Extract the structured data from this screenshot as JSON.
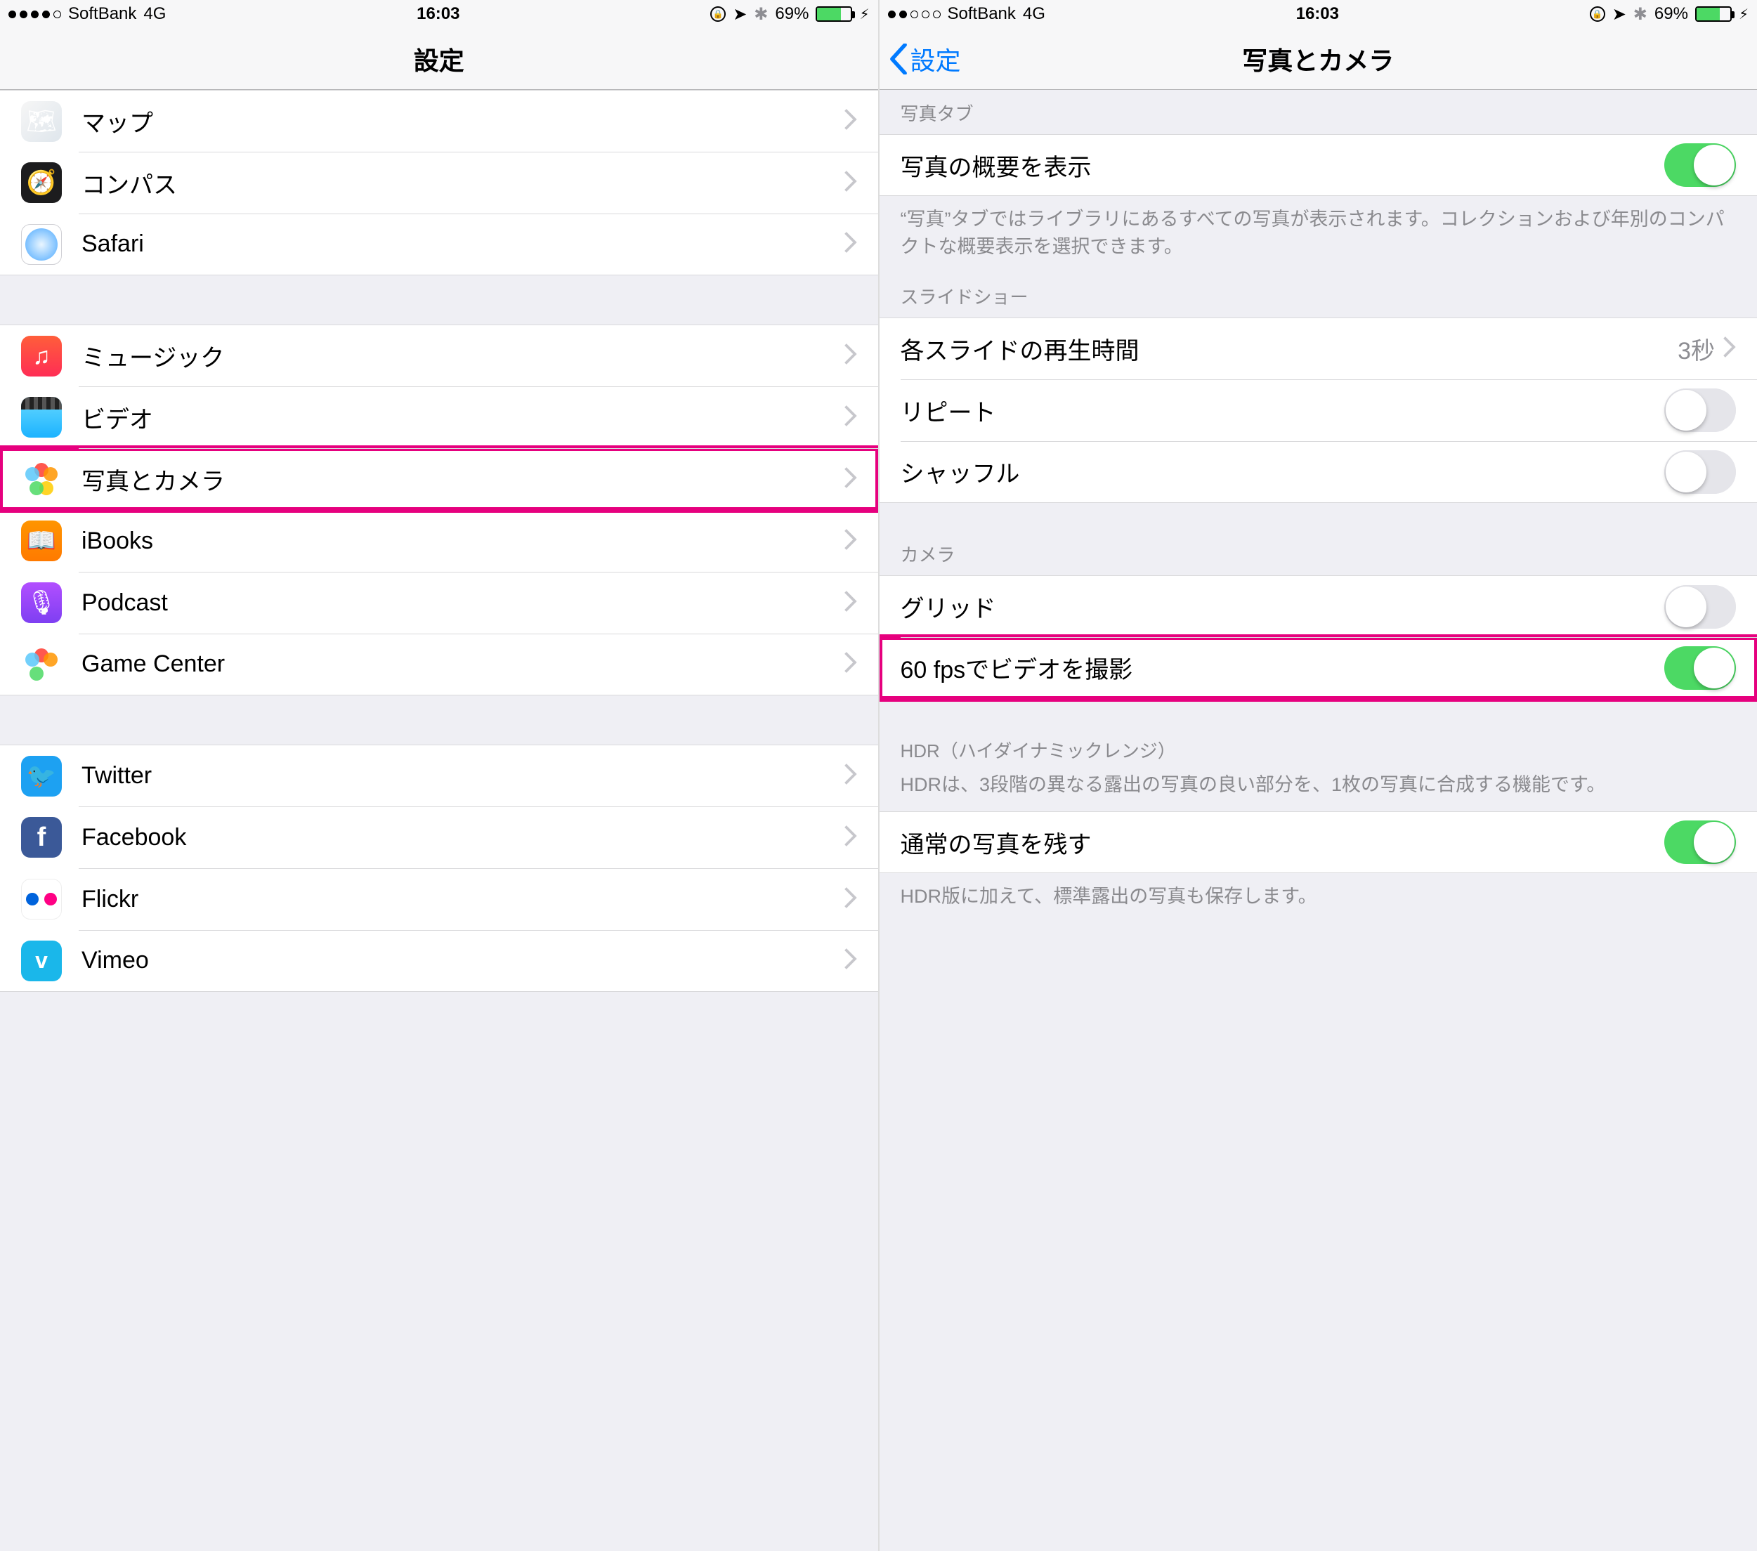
{
  "status": {
    "carrier": "SoftBank",
    "network": "4G",
    "time": "16:03",
    "battery_pct": "69%",
    "signal_left_full": 4,
    "signal_right_full": 2
  },
  "left": {
    "title": "設定",
    "groups": [
      {
        "items": [
          {
            "key": "maps",
            "label": "マップ",
            "icon": "maps-icon"
          },
          {
            "key": "compass",
            "label": "コンパス",
            "icon": "compass-icon"
          },
          {
            "key": "safari",
            "label": "Safari",
            "icon": "safari-icon"
          }
        ]
      },
      {
        "items": [
          {
            "key": "music",
            "label": "ミュージック",
            "icon": "music-icon"
          },
          {
            "key": "video",
            "label": "ビデオ",
            "icon": "video-icon"
          },
          {
            "key": "photos",
            "label": "写真とカメラ",
            "icon": "photos-icon",
            "highlight": true
          },
          {
            "key": "ibooks",
            "label": "iBooks",
            "icon": "ibooks-icon"
          },
          {
            "key": "podcast",
            "label": "Podcast",
            "icon": "podcast-icon"
          },
          {
            "key": "gamecenter",
            "label": "Game Center",
            "icon": "gamecenter-icon"
          }
        ]
      },
      {
        "items": [
          {
            "key": "twitter",
            "label": "Twitter",
            "icon": "twitter-icon"
          },
          {
            "key": "facebook",
            "label": "Facebook",
            "icon": "facebook-icon"
          },
          {
            "key": "flickr",
            "label": "Flickr",
            "icon": "flickr-icon"
          },
          {
            "key": "vimeo",
            "label": "Vimeo",
            "icon": "vimeo-icon"
          }
        ]
      }
    ]
  },
  "right": {
    "back": "設定",
    "title": "写真とカメラ",
    "sections": {
      "photo_tab": {
        "header": "写真タブ",
        "summarize": {
          "label": "写真の概要を表示",
          "on": true
        },
        "footer": "“写真”タブではライブラリにあるすべての写真が表示されます。コレクションおよび年別のコンパクトな概要表示を選択できます。"
      },
      "slideshow": {
        "header": "スライドショー",
        "duration": {
          "label": "各スライドの再生時間",
          "value": "3秒"
        },
        "repeat": {
          "label": "リピート",
          "on": false
        },
        "shuffle": {
          "label": "シャッフル",
          "on": false
        }
      },
      "camera": {
        "header": "カメラ",
        "grid": {
          "label": "グリッド",
          "on": false
        },
        "fps60": {
          "label": "60 fpsでビデオを撮影",
          "on": true,
          "highlight": true
        }
      },
      "hdr": {
        "header": "HDR（ハイダイナミックレンジ）",
        "desc": "HDRは、3段階の異なる露出の写真の良い部分を、1枚の写真に合成する機能です。",
        "keep": {
          "label": "通常の写真を残す",
          "on": true
        },
        "footer": "HDR版に加えて、標準露出の写真も保存します。"
      }
    }
  }
}
